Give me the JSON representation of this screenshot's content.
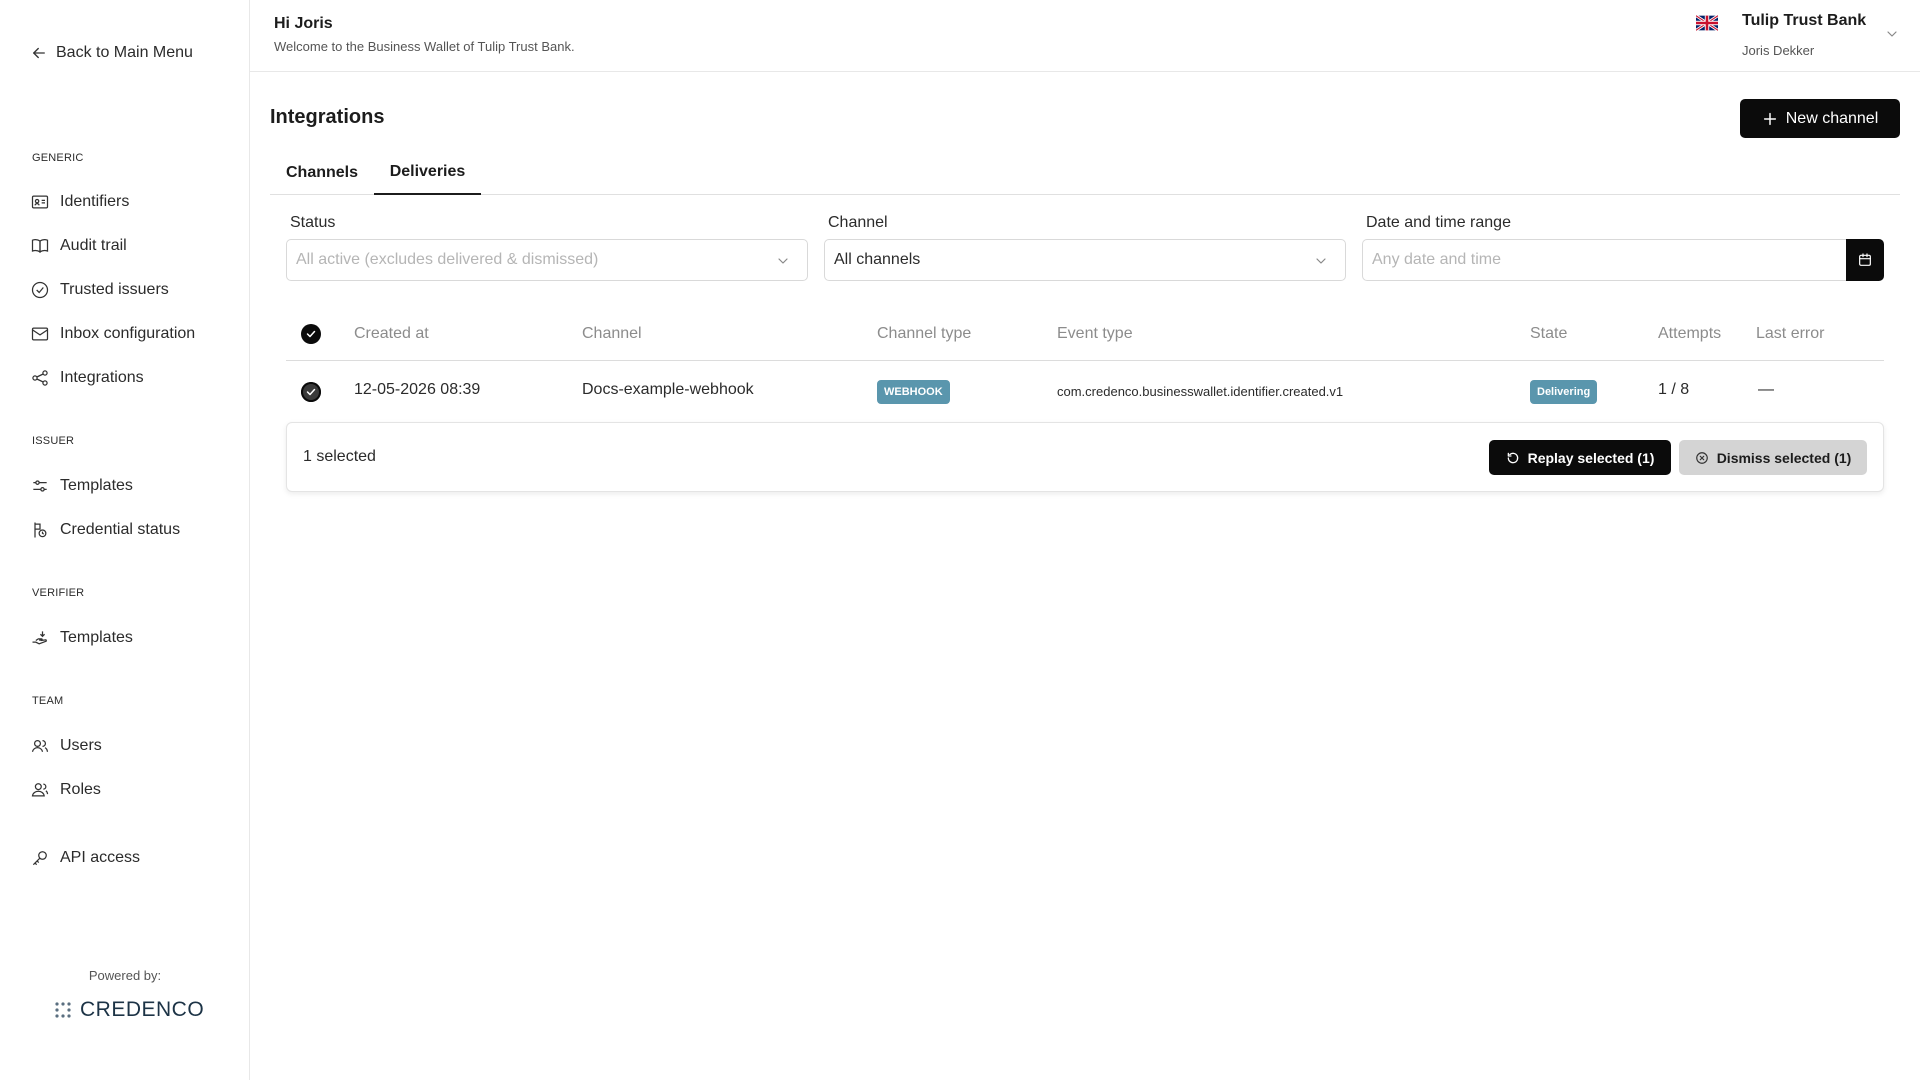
{
  "sidebar": {
    "back_label": "Back to Main Menu",
    "sections": {
      "generic": "GENERIC",
      "issuer": "ISSUER",
      "verifier": "VERIFIER",
      "team": "TEAM"
    },
    "items": {
      "identifiers": "Identifiers",
      "audit_trail": "Audit trail",
      "trusted_issuers": "Trusted issuers",
      "inbox_configuration": "Inbox configuration",
      "integrations": "Integrations",
      "issuer_templates": "Templates",
      "credential_status": "Credential status",
      "verifier_templates": "Templates",
      "users": "Users",
      "roles": "Roles",
      "api_access": "API access"
    },
    "powered_by": "Powered by:",
    "brand": "CREDENCO"
  },
  "header": {
    "greeting": "Hi Joris",
    "welcome": "Welcome to the Business Wallet of Tulip Trust Bank.",
    "organization": "Tulip Trust Bank",
    "user_name": "Joris Dekker",
    "flag_icon": "uk-flag-icon"
  },
  "main": {
    "title": "Integrations",
    "new_channel_label": "New channel",
    "tabs": [
      {
        "label": "Channels",
        "active": false
      },
      {
        "label": "Deliveries",
        "active": true
      }
    ],
    "filters": {
      "status_label": "Status",
      "status_placeholder": "All active (excludes delivered & dismissed)",
      "channel_label": "Channel",
      "channel_value": "All channels",
      "date_label": "Date and time range",
      "date_placeholder": "Any date and time"
    },
    "table": {
      "columns": [
        "Created at",
        "Channel",
        "Channel type",
        "Event type",
        "State",
        "Attempts",
        "Last error"
      ],
      "rows": [
        {
          "created_at": "12-05-2026 08:39",
          "channel": "Docs-example-webhook",
          "channel_type": "WEBHOOK",
          "event_type": "com.credenco.businesswallet.identifier.created.v1",
          "state": "Delivering",
          "attempts": "1 / 8",
          "last_error": "—",
          "selected": true
        }
      ]
    },
    "selection": {
      "count_label": "1 selected",
      "replay_label": "Replay selected (1)",
      "dismiss_label": "Dismiss selected (1)"
    }
  },
  "colors": {
    "primary": "#0b0b0b",
    "badge": "#5a96ad",
    "dismiss_bg": "#d4d4d4",
    "brand_text": "#1c3346"
  }
}
